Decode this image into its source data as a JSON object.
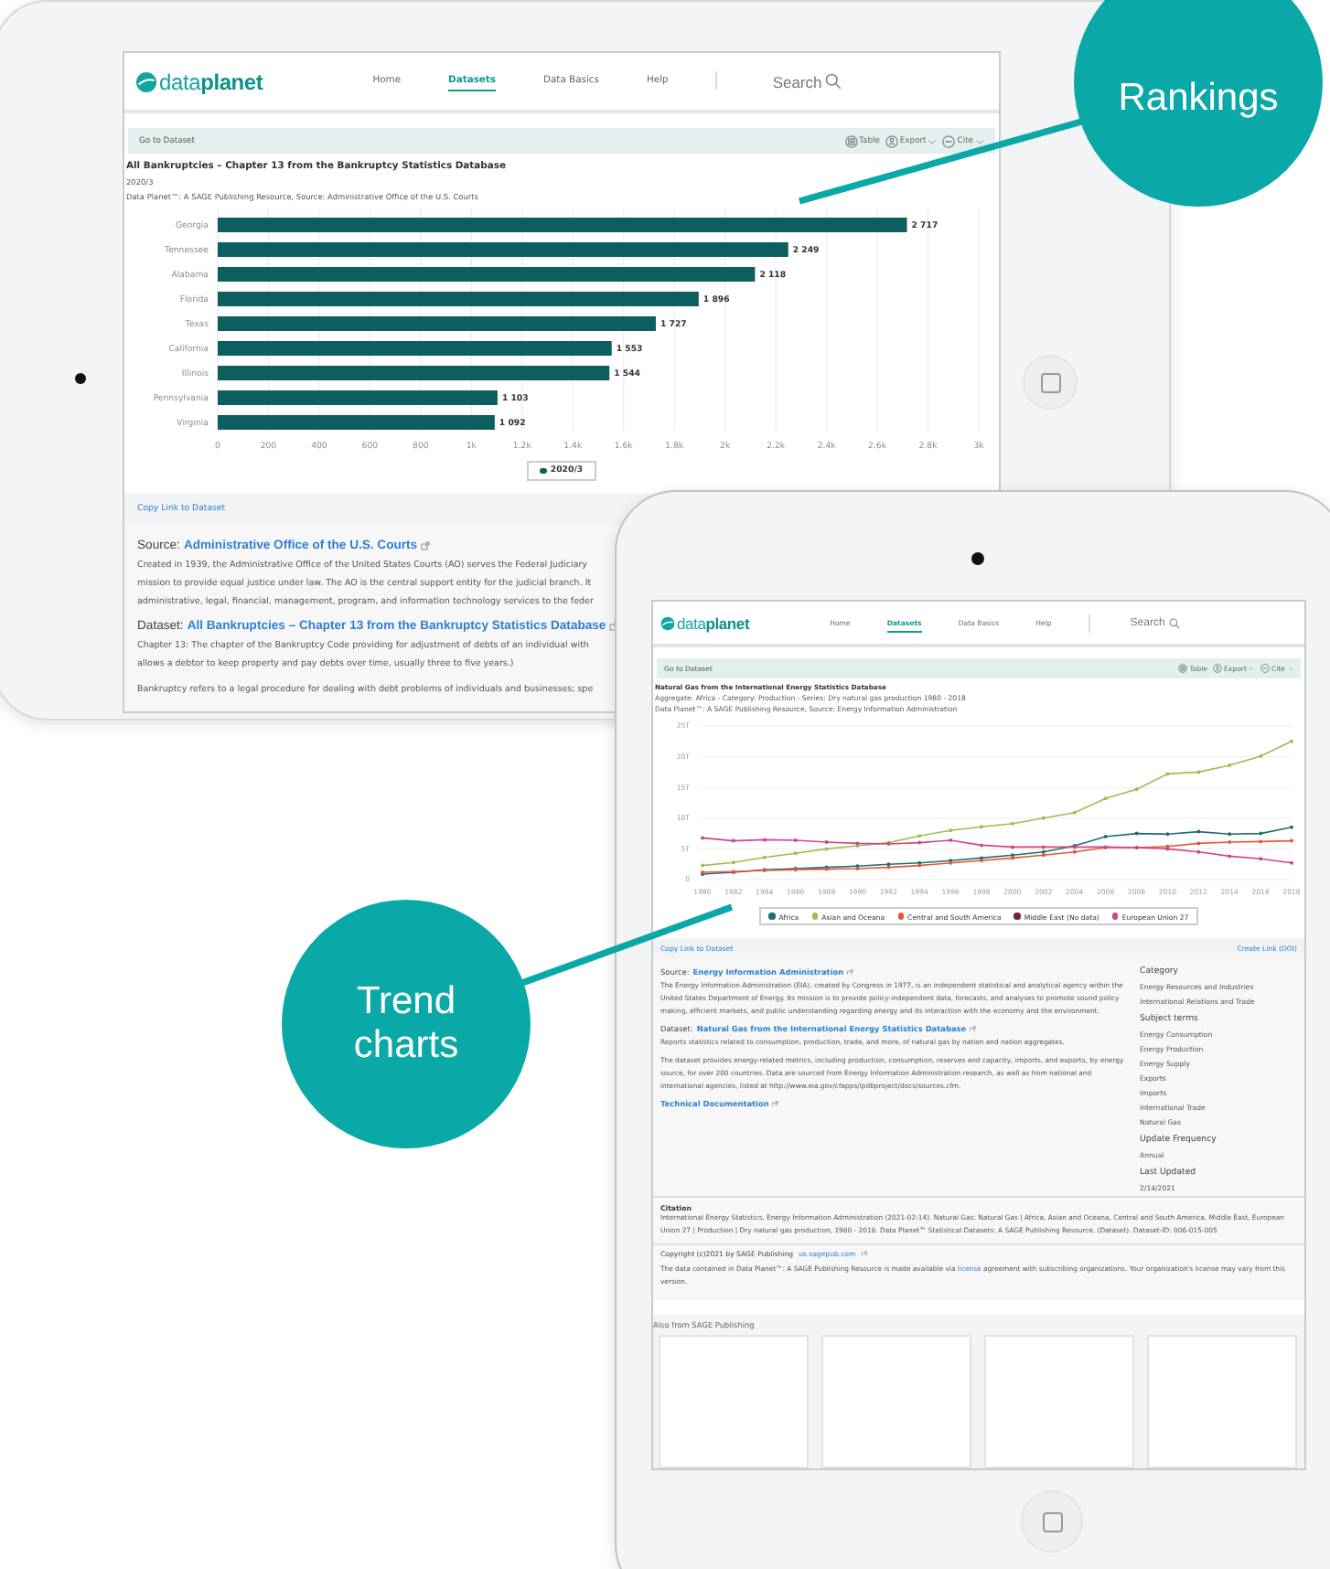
{
  "callouts": [
    {
      "label": "Rankings"
    },
    {
      "label": "Trend charts"
    }
  ],
  "tablet_back": {
    "header": {
      "logo": "data**planet**",
      "nav": [
        {
          "label": "Home",
          "selected": false
        },
        {
          "label": "Datasets",
          "selected": true
        },
        {
          "label": "Data Basics",
          "selected": false
        },
        {
          "label": "Help",
          "selected": false
        }
      ],
      "search": "Search"
    },
    "toolbar": {
      "link": "Go to Dataset",
      "actions": [
        {
          "label": "Table",
          "kind": "table"
        },
        {
          "label": "Export",
          "kind": "export"
        },
        {
          "label": "Cite",
          "kind": "cite"
        }
      ]
    },
    "title": "All Bankruptcies – Chapter 13 from the Bankruptcy Statistics Database",
    "period": "2020/3",
    "source_line": "Data Planet™: A SAGE Publishing Resource, Source: Administrative Office of the U.S. Courts",
    "chart_data": {
      "type": "bar",
      "orientation": "horizontal",
      "categories": [
        "Georgia",
        "Tennessee",
        "Alabama",
        "Florida",
        "Texas",
        "California",
        "Illinois",
        "Pennsylvania",
        "Virginia"
      ],
      "series": [
        {
          "name": "2020/3",
          "color": "#0d5e5e",
          "values": [
            2717,
            2249,
            2118,
            1896,
            1727,
            1553,
            1544,
            1103,
            1092
          ]
        }
      ],
      "value_labels": [
        "2 717",
        "2 249",
        "2 118",
        "1 896",
        "1 727",
        "1 553",
        "1 544",
        "1 103",
        "1 092"
      ],
      "xlim": [
        0,
        3000
      ],
      "grid": true,
      "legend": "bottom",
      "xticks": [
        0,
        200,
        400,
        600,
        800,
        {
          "value": 1000,
          "label": "1k"
        },
        {
          "value": 1200,
          "label": "1.2k"
        },
        {
          "value": 1400,
          "label": "1.4k"
        },
        {
          "value": 1600,
          "label": "1.6k"
        },
        {
          "value": 1800,
          "label": "1.8k"
        },
        {
          "value": 2000,
          "label": "2k"
        },
        {
          "value": 2200,
          "label": "2.2k"
        },
        {
          "value": 2400,
          "label": "2.4k"
        },
        {
          "value": 2600,
          "label": "2.6k"
        },
        {
          "value": 2800,
          "label": "2.8k"
        },
        {
          "value": 3000,
          "label": "3k"
        }
      ]
    },
    "copy_link": "Copy Link to Dataset",
    "source": {
      "label": "Source:",
      "link": "Administrative Office of the U.S. Courts",
      "lines": [
        "Created in 1939, the Administrative Office of the United States Courts (AO) serves the Federal Judiciary",
        "mission to provide equal justice under law. The AO is the central support entity for the judicial branch. It",
        "administrative, legal, financial, management, program, and information technology services to the feder"
      ]
    },
    "dataset": {
      "label": "Dataset:",
      "link": "All Bankruptcies – Chapter 13 from the Bankruptcy Statistics Database",
      "lines": [
        "Chapter 13: The chapter of the Bankruptcy Code providing for adjustment of debts of an individual with",
        "allows a debtor to keep property and pay debts over time, usually three to five years.)"
      ]
    },
    "note": "Bankruptcy refers to a legal procedure for dealing with debt problems of individuals and businesses; spe"
  },
  "tablet_front": {
    "header": {
      "logo": "data**planet**",
      "nav": [
        {
          "label": "Home",
          "selected": false
        },
        {
          "label": "Datasets",
          "selected": true
        },
        {
          "label": "Data Basics",
          "selected": false
        },
        {
          "label": "Help",
          "selected": false
        }
      ],
      "search": "Search"
    },
    "toolbar": {
      "link": "Go to Dataset",
      "actions": [
        {
          "label": "Table",
          "kind": "table"
        },
        {
          "label": "Export",
          "kind": "export"
        },
        {
          "label": "Cite",
          "kind": "cite"
        }
      ]
    },
    "title": "Natural Gas from the International Energy Statistics Database",
    "aggregate": "Aggregate: Africa - Category: Production - Series: Dry natural gas production 1980 - 2018",
    "source_line": "Data Planet™: A SAGE Publishing Resource, Source: Energy Information Administration",
    "chart_data": {
      "type": "line",
      "x": [
        1980,
        1982,
        1984,
        1986,
        1988,
        1990,
        1992,
        1994,
        1996,
        1998,
        2000,
        2002,
        2004,
        2006,
        2008,
        2010,
        2012,
        2014,
        2016,
        2018
      ],
      "series": [
        {
          "name": "Africa",
          "color": "#1f6e70",
          "values": [
            0.9,
            1.2,
            1.6,
            1.8,
            2.0,
            2.2,
            2.5,
            2.7,
            3.1,
            3.5,
            4.0,
            4.5,
            5.5,
            7.0,
            7.5,
            7.4,
            7.8,
            7.4,
            7.5,
            8.5
          ]
        },
        {
          "name": "Asian and Oceana",
          "color": "#9dbf4e",
          "values": [
            2.3,
            2.8,
            3.6,
            4.3,
            5.0,
            5.5,
            6.0,
            7.1,
            8.0,
            8.6,
            9.1,
            10.0,
            10.9,
            13.2,
            14.7,
            17.2,
            17.5,
            18.6,
            20.1,
            22.5
          ]
        },
        {
          "name": "Central and South America",
          "color": "#e5573b",
          "values": [
            1.2,
            1.3,
            1.5,
            1.6,
            1.7,
            1.8,
            2.0,
            2.3,
            2.7,
            3.1,
            3.5,
            4.0,
            4.5,
            5.2,
            5.2,
            5.4,
            5.9,
            6.1,
            6.2,
            6.3
          ]
        },
        {
          "name": "Middle East (No data)",
          "color": "#7a2040",
          "values": [
            null,
            null,
            null,
            null,
            null,
            null,
            null,
            null,
            null,
            null,
            null,
            null,
            null,
            null,
            null,
            null,
            null,
            null,
            null,
            null
          ]
        },
        {
          "name": "European Union 27",
          "color": "#d0448a",
          "values": [
            6.8,
            6.3,
            6.5,
            6.4,
            6.1,
            5.9,
            5.8,
            6.0,
            6.4,
            5.6,
            5.3,
            5.3,
            5.3,
            5.3,
            5.2,
            5.0,
            4.5,
            3.8,
            3.4,
            2.7
          ]
        }
      ],
      "xticks": [
        1980,
        1982,
        1984,
        1986,
        1988,
        1990,
        1992,
        1994,
        1996,
        1998,
        2000,
        2002,
        2004,
        2006,
        2008,
        2010,
        2012,
        2014,
        2016,
        2018
      ],
      "xlim": [
        1980,
        2018
      ],
      "ylim": [
        0,
        25
      ],
      "grid": true,
      "legend": "bottom",
      "yticks": [
        0,
        {
          "value": 5,
          "label": "5T"
        },
        {
          "value": 10,
          "label": "10T"
        },
        {
          "value": 15,
          "label": "15T"
        },
        {
          "value": 20,
          "label": "20T"
        },
        {
          "value": 25,
          "label": "25T"
        }
      ]
    },
    "copy_link": "Copy Link to Dataset",
    "doi_link": "Create Link (DOI)",
    "source": {
      "label": "Source:",
      "link": "Energy Information Administration",
      "text": "The Energy Information Administration (EIA), created by Congress in 1977, is an independent statistical and analytical agency within the United States Department of Energy. Its mission is to provide policy-independent data, forecasts, and analyses to promote sound policy making, efficient markets, and public understanding regarding energy and its interaction with the economy and the environment."
    },
    "dataset": {
      "label": "Dataset:",
      "link": "Natural Gas from the International Energy Statistics Database",
      "paragraphs": [
        "Reports statistics related to consumption, production, trade, and more, of natural gas by nation and nation aggregates.",
        "The dataset provides energy-related metrics, including production, consumption, reserves and capacity, imports, and exports, by energy source, for over 200 countries. Data are sourced from Energy Information Administration research, as well as from national and international agencies, listed at http://www.eia.gov/cfapps/ipdbproject/docs/sources.cfm."
      ]
    },
    "tech_doc": "Technical Documentation",
    "sidebar": [
      {
        "heading": "Category",
        "items": [
          "Energy Resources and Industries",
          "International Relations and Trade"
        ]
      },
      {
        "heading": "Subject terms",
        "items": [
          "Energy Consumption",
          "Energy Production",
          "Energy Supply",
          "Exports",
          "Imports",
          "International Trade",
          "Natural Gas"
        ]
      },
      {
        "heading": "Update Frequency",
        "items": [
          "Annual"
        ]
      },
      {
        "heading": "Last Updated",
        "items": [
          "2/14/2021"
        ]
      }
    ],
    "citation": {
      "heading": "Citation",
      "text": "International Energy Statistics, Energy Information Administration (2021-02-14). Natural Gas: Natural Gas | Africa, Asian and Oceana, Central and South America, Middle East, European Union 27 | Production | Dry natural gas production, 1980 - 2018. Data Planet™ Statistical Datasets: A SAGE Publishing Resource. (Dataset). Dataset-ID: 006-015-005"
    },
    "copyright": {
      "text": "Copyright (c)2021 by SAGE Publishing",
      "link": "us.sagepub.com"
    },
    "license": {
      "before": "The data contained in Data Planet™: A SAGE Publishing Resource is made available via",
      "link": "license",
      "after": "agreement with subscribing organizations. Your organization's license may vary from this version."
    },
    "also_heading": "Also from SAGE Publishing"
  }
}
